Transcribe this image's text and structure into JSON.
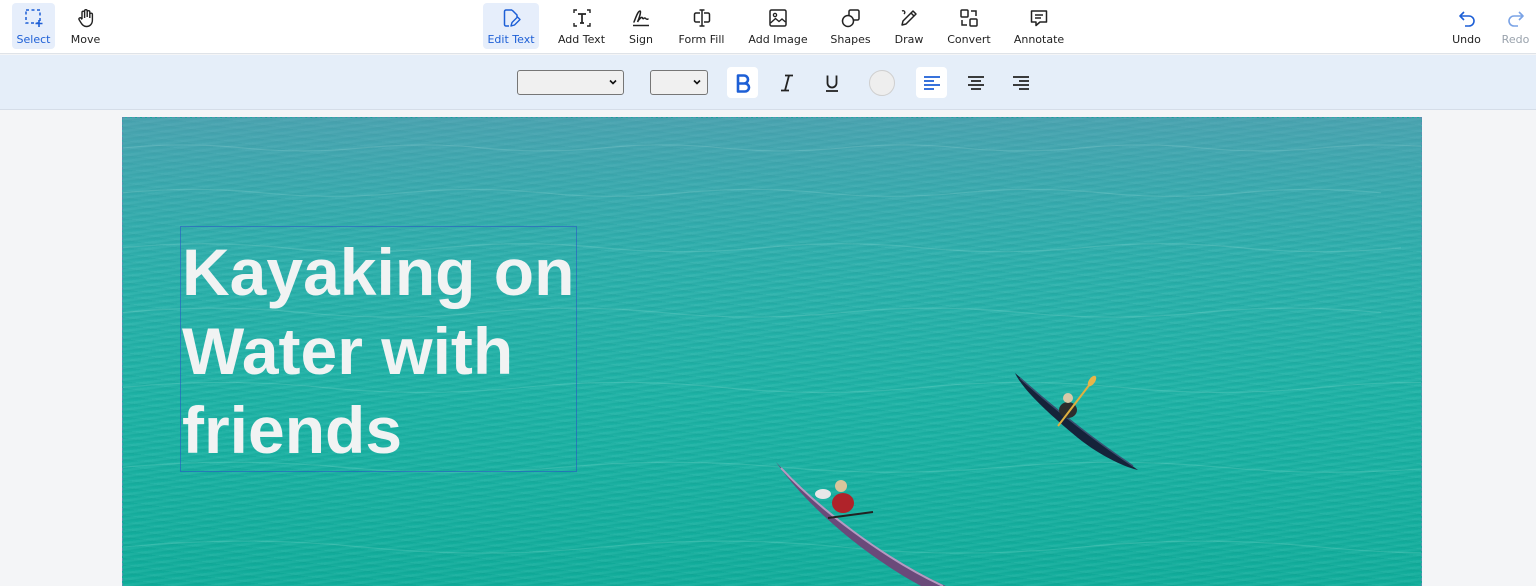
{
  "toolbar": {
    "left_tools": [
      {
        "label": "Select",
        "icon": "select-dashed-icon",
        "active": true
      },
      {
        "label": "Move",
        "icon": "hand-icon",
        "active": false
      }
    ],
    "center_tools": [
      {
        "label": "Edit Text",
        "icon": "edit-text-icon",
        "active": true
      },
      {
        "label": "Add Text",
        "icon": "add-text-icon",
        "active": false
      },
      {
        "label": "Sign",
        "icon": "signature-icon",
        "active": false
      },
      {
        "label": "Form Fill",
        "icon": "form-fill-icon",
        "active": false
      },
      {
        "label": "Add Image",
        "icon": "image-icon",
        "active": false
      },
      {
        "label": "Shapes",
        "icon": "shapes-icon",
        "active": false
      },
      {
        "label": "Draw",
        "icon": "pencil-icon",
        "active": false
      },
      {
        "label": "Convert",
        "icon": "convert-icon",
        "active": false
      },
      {
        "label": "Annotate",
        "icon": "comment-icon",
        "active": false
      }
    ],
    "right_tools": [
      {
        "label": "Undo",
        "icon": "undo-icon",
        "enabled": true
      },
      {
        "label": "Redo",
        "icon": "redo-icon",
        "enabled": false
      }
    ]
  },
  "format_bar": {
    "font_family_value": "",
    "font_size_value": "",
    "bold_active": true,
    "italic_active": false,
    "underline_active": false,
    "text_color": "#eeeeee",
    "align_active": "left"
  },
  "document": {
    "heading_lines": [
      "Kayaking on",
      "Water with",
      "friends"
    ]
  },
  "colors": {
    "accent": "#1d5fd6",
    "active_tool_bg": "#e6eefb",
    "format_bar_bg": "#e5eef9",
    "water": "#1bb3a5",
    "heading_text": "#f1f3f3"
  }
}
